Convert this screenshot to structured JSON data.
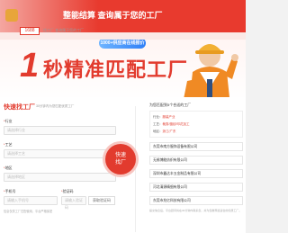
{
  "banner": {
    "title": "整能结算 查询属于您的工厂"
  },
  "nav": {
    "logo": "1688",
    "text": "找工厂 查询属于您的工厂"
  },
  "hero": {
    "pill": "1000+供应商在线报价",
    "number": "1",
    "headline": "秒精准匹配工厂"
  },
  "form": {
    "title": "快速找工厂",
    "subtitle": "30分钟内为您匹配优质工厂",
    "fields": [
      {
        "label": "行业",
        "placeholder": "请选择行业"
      },
      {
        "label": "工艺",
        "placeholder": "请选择工艺"
      },
      {
        "label": "地区",
        "placeholder": "请选择地区"
      }
    ],
    "phone_label": "手机号",
    "phone_placeholder": "请输入手机号",
    "code_label": "验证码",
    "code_placeholder": "请输入验证码",
    "code_button": "获取验证码",
    "note": "信息仅供工厂匹配使用，平台严格保密"
  },
  "submit": {
    "line1": "快速",
    "line2": "找厂"
  },
  "results": {
    "title": "为您匹配到5个合适的工厂",
    "summary": [
      {
        "key": "行业：",
        "value": "服装产业"
      },
      {
        "key": "工艺：",
        "value": "裁剪/缝纫/印花加工"
      },
      {
        "key": "地区：",
        "value": "浙江/广东"
      }
    ],
    "factories": [
      "东莞市南方服饰设备有限公司",
      "无锡博能纺织有限公司",
      "深圳市鑫达丰五金制品有限公司",
      "河北清源精细有限公司",
      "东莞市兆亿科技有限公司"
    ],
    "note": "提交信息后，平台顾问将在30分钟内联系您，并为您推荐最适合的优质工厂。"
  }
}
